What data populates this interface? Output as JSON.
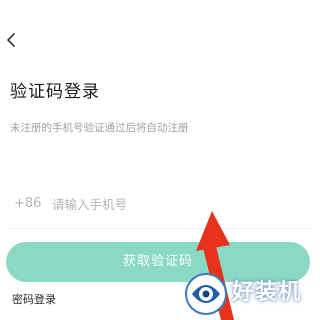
{
  "header": {
    "back_icon": "chevron-left-icon"
  },
  "login": {
    "title": "验证码登录",
    "subtitle": "未注册的手机号验证通过后将自动注册",
    "country_code": "+86",
    "phone_placeholder": "请输入手机号",
    "phone_value": "",
    "get_code_label": "获取验证码",
    "password_login_label": "密码登录"
  },
  "overlay": {
    "arrow_color": "#e8331c",
    "arrow_icon": "red-arrow-annotation"
  },
  "watermark": {
    "text": "好装机",
    "logo_icon": "watermark-logo-icon"
  },
  "colors": {
    "accent": "#8ad9c4",
    "title": "#1a1a1a",
    "muted": "#a2a2a2"
  }
}
